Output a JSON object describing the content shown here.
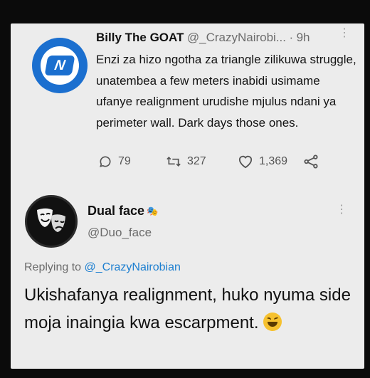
{
  "tweet": {
    "author_name": "Billy The GOAT",
    "author_handle": "@_CrazyNairobi...",
    "separator": "·",
    "time": "9h",
    "avatar_letter": "N",
    "text": "Enzi za hizo ngotha za triangle zilikuwa struggle, unatembea a few meters inabidi usimame ufanye realignment urudishe mjulus ndani ya perimeter wall. Dark days those ones.",
    "replies": "79",
    "retweets": "327",
    "likes": "1,369"
  },
  "reply": {
    "author_name": "Dual face",
    "author_handle": "@Duo_face",
    "replying_prefix": "Replying to",
    "replying_to": "@_CrazyNairobian",
    "text": "Ukishafanya realignment, huko nyuma side moja inaingia kwa escarpment."
  },
  "icons": {
    "reply": "comment-icon",
    "retweet": "retweet-icon",
    "like": "heart-icon",
    "share": "share-icon",
    "more": "more-vertical-icon"
  },
  "colors": {
    "card": "#ececec",
    "background": "#0b0b0b",
    "link": "#1d7fd0",
    "avatar_blue": "#1b6fcf"
  }
}
